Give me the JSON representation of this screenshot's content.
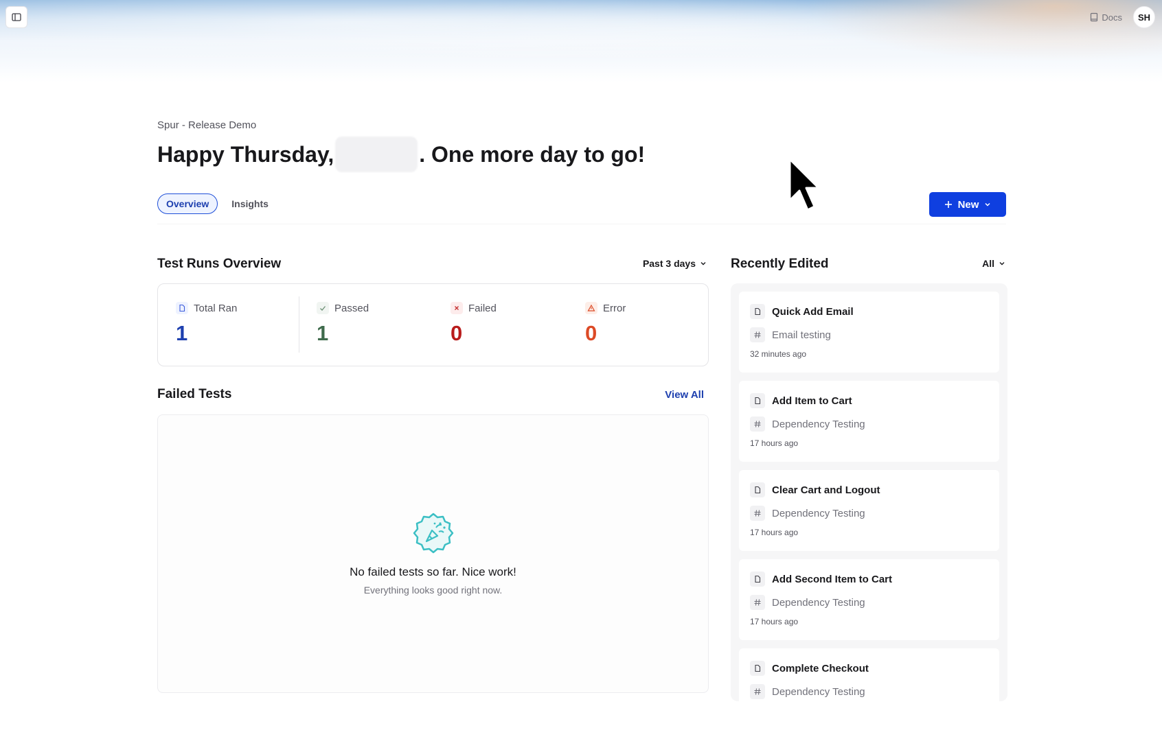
{
  "topbar": {
    "docs_label": "Docs",
    "avatar_initials": "SH"
  },
  "header": {
    "workspace": "Spur - Release Demo",
    "greeting_prefix": "Happy Thursday,",
    "greeting_suffix": ". One more day to go!"
  },
  "tabs": [
    {
      "label": "Overview",
      "active": true
    },
    {
      "label": "Insights",
      "active": false
    }
  ],
  "new_button": {
    "label": "New"
  },
  "test_runs": {
    "title": "Test Runs Overview",
    "range": "Past 3 days",
    "stats": [
      {
        "label": "Total Ran",
        "value": "1",
        "color": "#1e40af"
      },
      {
        "label": "Passed",
        "value": "1",
        "color": "#3f6b4c"
      },
      {
        "label": "Failed",
        "value": "0",
        "color": "#b91c1c"
      },
      {
        "label": "Error",
        "value": "0",
        "color": "#dc4a26"
      }
    ]
  },
  "failed_tests": {
    "title": "Failed Tests",
    "view_all": "View All",
    "empty_title": "No failed tests so far. Nice work!",
    "empty_subtitle": "Everything looks good right now."
  },
  "recently_edited": {
    "title": "Recently Edited",
    "filter": "All",
    "items": [
      {
        "title": "Quick Add Email",
        "tag": "Email testing",
        "time": "32 minutes ago"
      },
      {
        "title": "Add Item to Cart",
        "tag": "Dependency Testing",
        "time": "17 hours ago"
      },
      {
        "title": "Clear Cart and Logout",
        "tag": "Dependency Testing",
        "time": "17 hours ago"
      },
      {
        "title": "Add Second Item to Cart",
        "tag": "Dependency Testing",
        "time": "17 hours ago"
      },
      {
        "title": "Complete Checkout",
        "tag": "Dependency Testing",
        "time": ""
      }
    ]
  },
  "colors": {
    "accent": "#0f3fe0",
    "active_tab": "#1e40af",
    "empty_icon": "#3bbfc4"
  }
}
